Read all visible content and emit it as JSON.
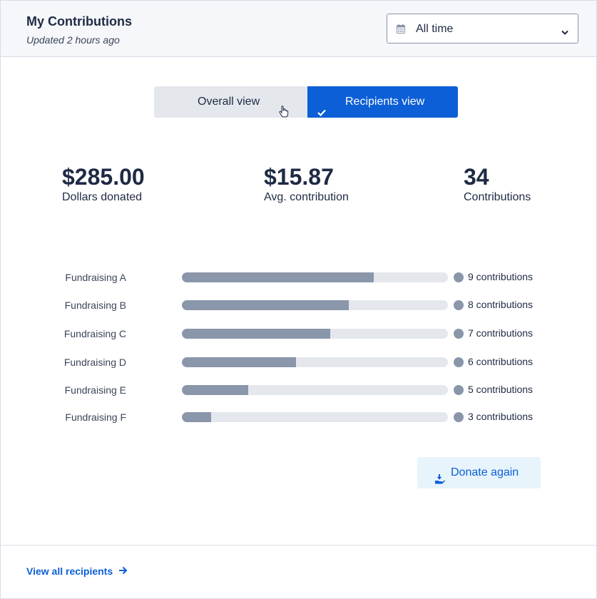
{
  "header": {
    "title": "My Contributions",
    "subtitle": "Updated 2 hours ago",
    "date_filter": {
      "selected": "All time",
      "icon": "calendar-icon"
    }
  },
  "view_toggle": {
    "overall_label": "Overall view",
    "recipients_label": "Recipients view",
    "active": "recipients"
  },
  "stats": [
    {
      "value": "$285.00",
      "label": "Dollars donated"
    },
    {
      "value": "$15.87",
      "label": "Avg. contribution"
    },
    {
      "value": "34",
      "label": "Contributions"
    }
  ],
  "recipients": [
    {
      "name": "Fundraising A",
      "count_label": "9 contributions",
      "fill_fraction": 0.72
    },
    {
      "name": "Fundraising B",
      "count_label": "8 contributions",
      "fill_fraction": 0.627
    },
    {
      "name": "Fundraising C",
      "count_label": "7 contributions",
      "fill_fraction": 0.557
    },
    {
      "name": "Fundraising D",
      "count_label": "6 contributions",
      "fill_fraction": 0.43
    },
    {
      "name": "Fundraising E",
      "count_label": "5 contributions",
      "fill_fraction": 0.25
    },
    {
      "name": "Fundraising F",
      "count_label": "3 contributions",
      "fill_fraction": 0.11
    }
  ],
  "actions": {
    "donate_label": "Donate again"
  },
  "footer": {
    "view_all_label": "View all recipients"
  },
  "colors": {
    "accent": "#0c5fd6",
    "bar_fill": "#8a96aa",
    "bar_track": "#e4e8ed",
    "donate_bg": "#e7f4fb"
  }
}
